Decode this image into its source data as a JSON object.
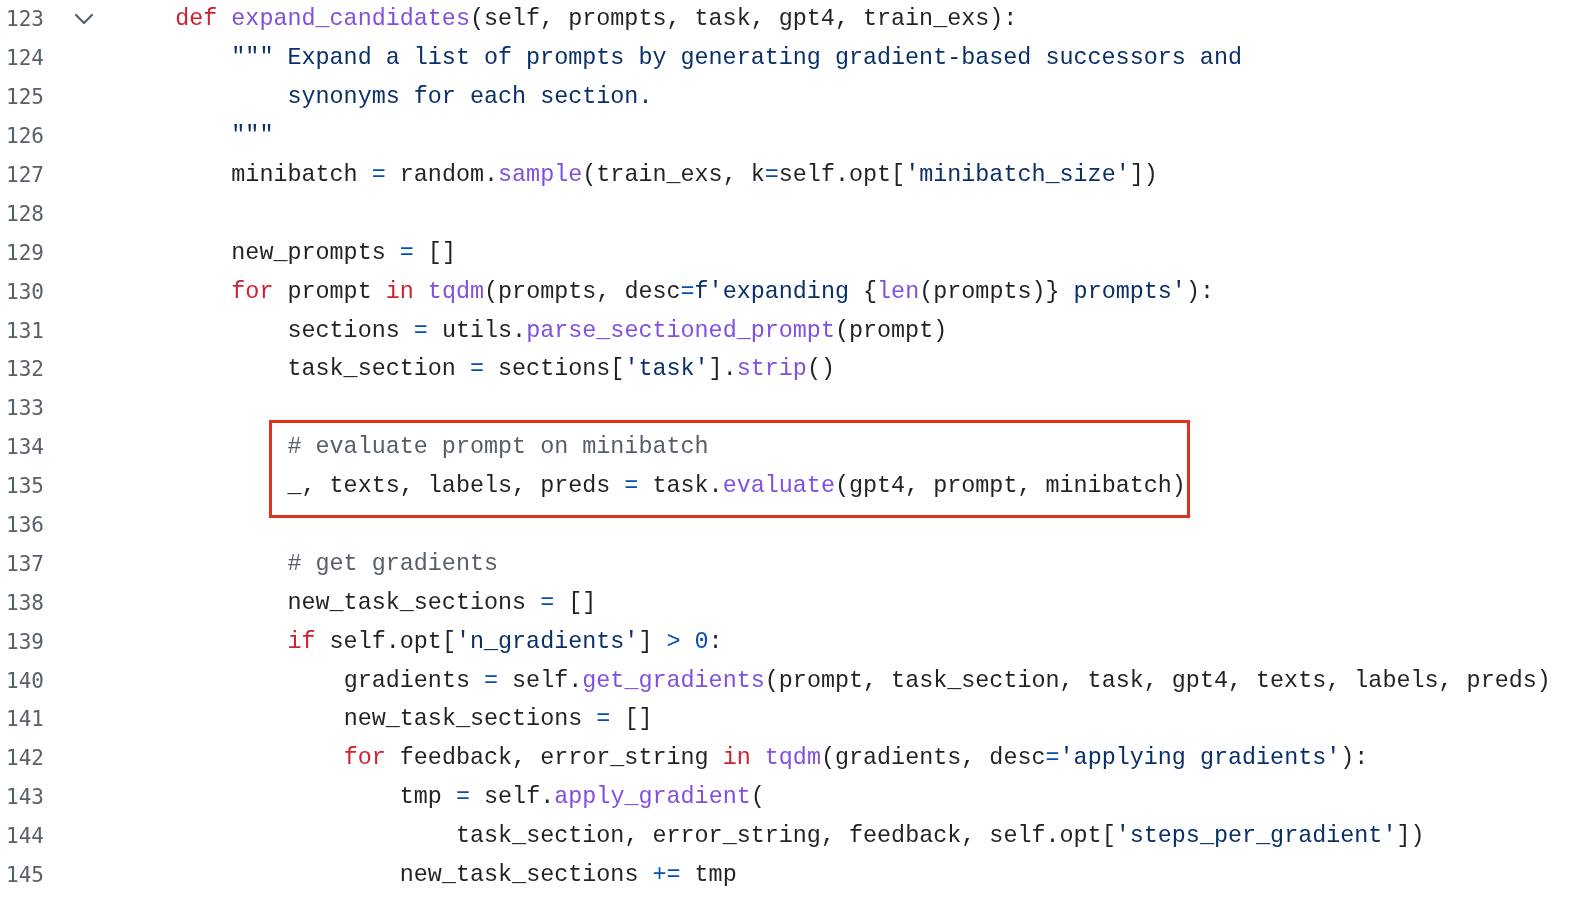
{
  "lines": [
    {
      "number": "123",
      "foldable": true,
      "highlighted": false,
      "tokens": [
        {
          "kind": "kw",
          "text": "    def "
        },
        {
          "kind": "fn",
          "text": "expand_candidates"
        },
        {
          "kind": "p",
          "text": "(self, prompts, task, gpt4, train_exs):"
        }
      ]
    },
    {
      "number": "124",
      "foldable": false,
      "highlighted": false,
      "tokens": [
        {
          "kind": "str",
          "text": "        \"\"\" Expand a list of prompts by generating gradient-based successors and"
        }
      ]
    },
    {
      "number": "125",
      "foldable": false,
      "highlighted": false,
      "tokens": [
        {
          "kind": "str",
          "text": "            synonyms for each section."
        }
      ]
    },
    {
      "number": "126",
      "foldable": false,
      "highlighted": false,
      "tokens": [
        {
          "kind": "str",
          "text": "        \"\"\""
        }
      ]
    },
    {
      "number": "127",
      "foldable": false,
      "highlighted": false,
      "tokens": [
        {
          "kind": "p",
          "text": "        minibatch "
        },
        {
          "kind": "op",
          "text": "="
        },
        {
          "kind": "p",
          "text": " random."
        },
        {
          "kind": "fn",
          "text": "sample"
        },
        {
          "kind": "p",
          "text": "(train_exs, k"
        },
        {
          "kind": "op",
          "text": "="
        },
        {
          "kind": "p",
          "text": "self.opt["
        },
        {
          "kind": "str",
          "text": "'minibatch_size'"
        },
        {
          "kind": "p",
          "text": "])"
        }
      ]
    },
    {
      "number": "128",
      "foldable": false,
      "highlighted": false
    },
    {
      "number": "129",
      "foldable": false,
      "highlighted": false,
      "tokens": [
        {
          "kind": "p",
          "text": "        new_prompts "
        },
        {
          "kind": "op",
          "text": "="
        },
        {
          "kind": "p",
          "text": " []"
        }
      ]
    },
    {
      "number": "130",
      "foldable": false,
      "highlighted": false,
      "tokens": [
        {
          "kind": "kw",
          "text": "        for"
        },
        {
          "kind": "p",
          "text": " prompt "
        },
        {
          "kind": "kw",
          "text": "in "
        },
        {
          "kind": "fn",
          "text": "tqdm"
        },
        {
          "kind": "p",
          "text": "(prompts, desc"
        },
        {
          "kind": "op",
          "text": "="
        },
        {
          "kind": "str",
          "text": "f'expanding "
        },
        {
          "kind": "p",
          "text": "{"
        },
        {
          "kind": "fn",
          "text": "len"
        },
        {
          "kind": "p",
          "text": "(prompts)}"
        },
        {
          "kind": "str",
          "text": " prompts'"
        },
        {
          "kind": "p",
          "text": "):"
        }
      ]
    },
    {
      "number": "131",
      "foldable": false,
      "highlighted": false,
      "tokens": [
        {
          "kind": "p",
          "text": "            sections "
        },
        {
          "kind": "op",
          "text": "="
        },
        {
          "kind": "p",
          "text": " utils."
        },
        {
          "kind": "fn",
          "text": "parse_sectioned_prompt"
        },
        {
          "kind": "p",
          "text": "(prompt)"
        }
      ]
    },
    {
      "number": "132",
      "foldable": false,
      "highlighted": false,
      "tokens": [
        {
          "kind": "p",
          "text": "            task_section "
        },
        {
          "kind": "op",
          "text": "="
        },
        {
          "kind": "p",
          "text": " sections["
        },
        {
          "kind": "str",
          "text": "'task'"
        },
        {
          "kind": "p",
          "text": "]."
        },
        {
          "kind": "fn",
          "text": "strip"
        },
        {
          "kind": "p",
          "text": "()"
        }
      ]
    },
    {
      "number": "133",
      "foldable": false,
      "highlighted": false
    },
    {
      "number": "134",
      "foldable": false,
      "highlighted": true,
      "tokens": [
        {
          "kind": "cm",
          "text": "            # evaluate prompt on minibatch"
        }
      ]
    },
    {
      "number": "135",
      "foldable": false,
      "highlighted": true,
      "tokens": [
        {
          "kind": "p",
          "text": "            _, texts, labels, preds "
        },
        {
          "kind": "op",
          "text": "="
        },
        {
          "kind": "p",
          "text": " task."
        },
        {
          "kind": "fn",
          "text": "evaluate"
        },
        {
          "kind": "p",
          "text": "(gpt4, prompt, minibatch)"
        }
      ]
    },
    {
      "number": "136",
      "foldable": false,
      "highlighted": false
    },
    {
      "number": "137",
      "foldable": false,
      "highlighted": false,
      "tokens": [
        {
          "kind": "cm",
          "text": "            # get gradients"
        }
      ]
    },
    {
      "number": "138",
      "foldable": false,
      "highlighted": false,
      "tokens": [
        {
          "kind": "p",
          "text": "            new_task_sections "
        },
        {
          "kind": "op",
          "text": "="
        },
        {
          "kind": "p",
          "text": " []"
        }
      ]
    },
    {
      "number": "139",
      "foldable": false,
      "highlighted": false,
      "tokens": [
        {
          "kind": "kw",
          "text": "            if"
        },
        {
          "kind": "p",
          "text": " self.opt["
        },
        {
          "kind": "str",
          "text": "'n_gradients'"
        },
        {
          "kind": "p",
          "text": "] "
        },
        {
          "kind": "op",
          "text": "> 0"
        },
        {
          "kind": "p",
          "text": ":"
        }
      ]
    },
    {
      "number": "140",
      "foldable": false,
      "highlighted": false,
      "tokens": [
        {
          "kind": "p",
          "text": "                gradients "
        },
        {
          "kind": "op",
          "text": "="
        },
        {
          "kind": "p",
          "text": " self."
        },
        {
          "kind": "fn",
          "text": "get_gradients"
        },
        {
          "kind": "p",
          "text": "(prompt, task_section, task, gpt4, texts, labels, preds)"
        }
      ]
    },
    {
      "number": "141",
      "foldable": false,
      "highlighted": false,
      "tokens": [
        {
          "kind": "p",
          "text": "                new_task_sections "
        },
        {
          "kind": "op",
          "text": "="
        },
        {
          "kind": "p",
          "text": " []"
        }
      ]
    },
    {
      "number": "142",
      "foldable": false,
      "highlighted": false,
      "tokens": [
        {
          "kind": "kw",
          "text": "                for"
        },
        {
          "kind": "p",
          "text": " feedback, error_string "
        },
        {
          "kind": "kw",
          "text": "in "
        },
        {
          "kind": "fn",
          "text": "tqdm"
        },
        {
          "kind": "p",
          "text": "(gradients, desc"
        },
        {
          "kind": "op",
          "text": "="
        },
        {
          "kind": "str",
          "text": "'applying gradients'"
        },
        {
          "kind": "p",
          "text": "):"
        }
      ]
    },
    {
      "number": "143",
      "foldable": false,
      "highlighted": false,
      "tokens": [
        {
          "kind": "p",
          "text": "                    tmp "
        },
        {
          "kind": "op",
          "text": "="
        },
        {
          "kind": "p",
          "text": " self."
        },
        {
          "kind": "fn",
          "text": "apply_gradient"
        },
        {
          "kind": "p",
          "text": "("
        }
      ]
    },
    {
      "number": "144",
      "foldable": false,
      "highlighted": false,
      "tokens": [
        {
          "kind": "p",
          "text": "                        task_section, error_string, feedback, self.opt["
        },
        {
          "kind": "str",
          "text": "'steps_per_gradient'"
        },
        {
          "kind": "p",
          "text": "])"
        }
      ]
    },
    {
      "number": "145",
      "foldable": false,
      "highlighted": false,
      "tokens": [
        {
          "kind": "p",
          "text": "                    new_task_sections "
        },
        {
          "kind": "op",
          "text": "+="
        },
        {
          "kind": "p",
          "text": " tmp"
        }
      ]
    }
  ]
}
